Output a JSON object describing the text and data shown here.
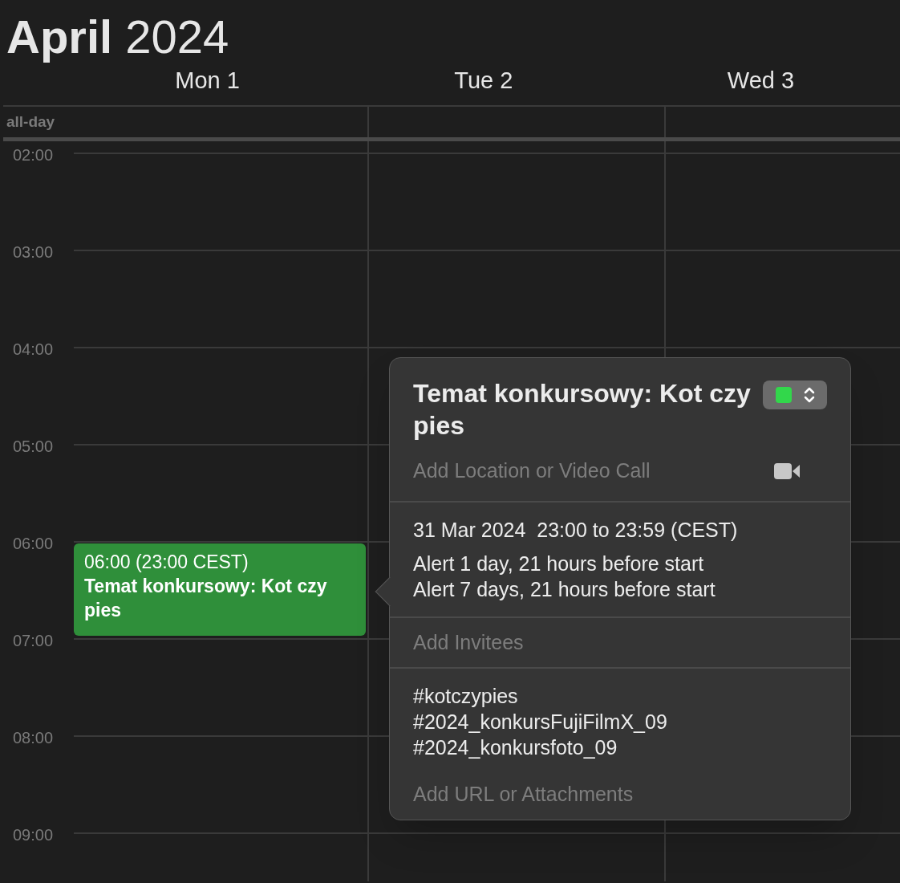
{
  "header": {
    "month": "April",
    "year": "2024"
  },
  "days": [
    {
      "label": "Mon 1"
    },
    {
      "label": "Tue 2"
    },
    {
      "label": "Wed 3"
    }
  ],
  "all_day_label": "all-day",
  "hours": [
    "02:00",
    "03:00",
    "04:00",
    "05:00",
    "06:00",
    "07:00",
    "08:00",
    "09:00"
  ],
  "event": {
    "time": "06:00 (23:00 CEST)",
    "title": "Temat konkursowy: Kot czy pies",
    "color": "#2f8f3a"
  },
  "popover": {
    "title": "Temat konkursowy: Kot czy pies",
    "calendar": {
      "color": "#32d74b"
    },
    "location_placeholder": "Add Location or Video Call",
    "date_line": "31 Mar 2024  23:00 to 23:59 (CEST)",
    "alerts": [
      "Alert 1 day, 21 hours before start",
      "Alert 7 days, 21 hours before start"
    ],
    "invitees_placeholder": "Add Invitees",
    "notes": [
      "#kotczypies",
      "#2024_konkursFujiFilmX_09",
      "#2024_konkursfoto_09"
    ],
    "url_placeholder": "Add URL or Attachments"
  }
}
